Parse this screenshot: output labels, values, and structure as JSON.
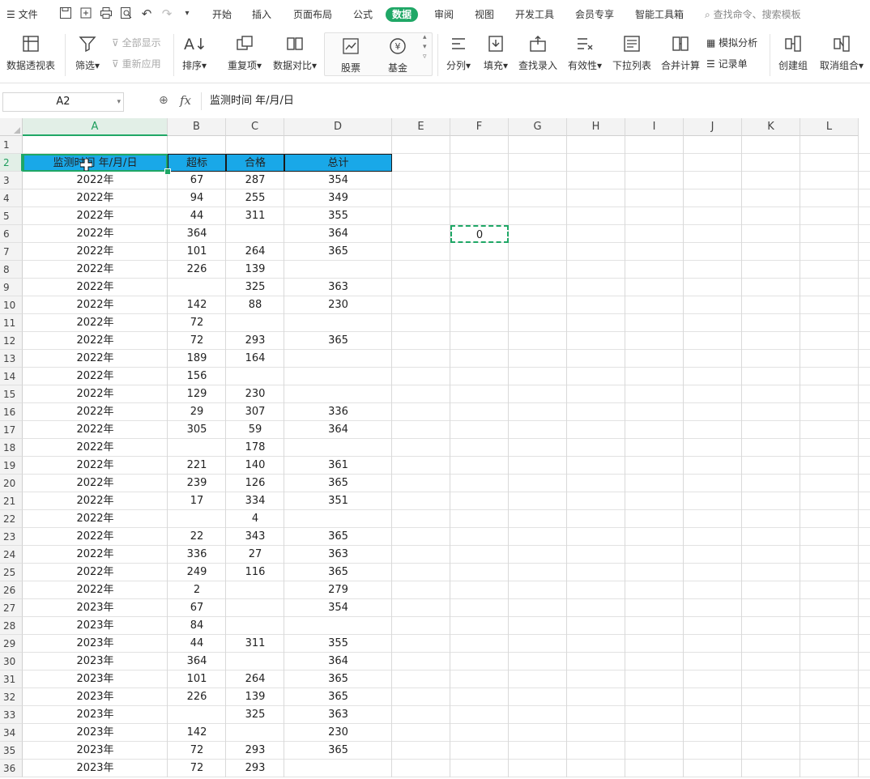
{
  "menubar": {
    "file_label": "文件",
    "tabs": [
      "开始",
      "插入",
      "页面布局",
      "公式",
      "数据",
      "审阅",
      "视图",
      "开发工具",
      "会员专享",
      "智能工具箱"
    ],
    "active_tab": "数据",
    "search_placeholder": "查找命令、搜索模板"
  },
  "ribbon": {
    "pivot": "数据透视表",
    "filter": "筛选",
    "show_all": "全部显示",
    "reapply": "重新应用",
    "sort": "排序",
    "duplicates": "重复项",
    "compare": "数据对比",
    "stock": "股票",
    "fund": "基金",
    "split": "分列",
    "fill": "填充",
    "lookup": "查找录入",
    "validity": "有效性",
    "dropdown": "下拉列表",
    "consolidate": "合并计算",
    "simulate": "模拟分析",
    "record": "记录单",
    "group": "创建组",
    "ungroup": "取消组合"
  },
  "formula_bar": {
    "name_box": "A2",
    "fx": "fx",
    "content": "监测时间 年/月/日"
  },
  "columns": [
    "A",
    "B",
    "C",
    "D",
    "E",
    "F",
    "G",
    "H",
    "I",
    "J",
    "K",
    "L"
  ],
  "rows": [
    "1",
    "2",
    "3",
    "4",
    "5",
    "6",
    "7",
    "8",
    "9",
    "10",
    "11",
    "12",
    "13",
    "14",
    "15",
    "16",
    "17",
    "18",
    "19",
    "20",
    "21",
    "22",
    "23",
    "24",
    "25",
    "26",
    "27",
    "28",
    "29",
    "30",
    "31",
    "32",
    "33",
    "34",
    "35",
    "36"
  ],
  "selected_cell": "A2",
  "header_row": [
    "监测时间 年/月/日",
    "超标",
    "合格",
    "总计"
  ],
  "data_rows": [
    [
      "2022年",
      "67",
      "287",
      "354"
    ],
    [
      "2022年",
      "94",
      "255",
      "349"
    ],
    [
      "2022年",
      "44",
      "311",
      "355"
    ],
    [
      "2022年",
      "364",
      "",
      "364"
    ],
    [
      "2022年",
      "101",
      "264",
      "365"
    ],
    [
      "2022年",
      "226",
      "139",
      ""
    ],
    [
      "2022年",
      "",
      "325",
      "363"
    ],
    [
      "2022年",
      "142",
      "88",
      "230"
    ],
    [
      "2022年",
      "72",
      "",
      ""
    ],
    [
      "2022年",
      "72",
      "293",
      "365"
    ],
    [
      "2022年",
      "189",
      "164",
      ""
    ],
    [
      "2022年",
      "156",
      "",
      ""
    ],
    [
      "2022年",
      "129",
      "230",
      ""
    ],
    [
      "2022年",
      "29",
      "307",
      "336"
    ],
    [
      "2022年",
      "305",
      "59",
      "364"
    ],
    [
      "2022年",
      "",
      "178",
      ""
    ],
    [
      "2022年",
      "221",
      "140",
      "361"
    ],
    [
      "2022年",
      "239",
      "126",
      "365"
    ],
    [
      "2022年",
      "17",
      "334",
      "351"
    ],
    [
      "2022年",
      "",
      "4",
      ""
    ],
    [
      "2022年",
      "22",
      "343",
      "365"
    ],
    [
      "2022年",
      "336",
      "27",
      "363"
    ],
    [
      "2022年",
      "249",
      "116",
      "365"
    ],
    [
      "2022年",
      "2",
      "",
      "279"
    ],
    [
      "2023年",
      "67",
      "",
      "354"
    ],
    [
      "2023年",
      "84",
      "",
      ""
    ],
    [
      "2023年",
      "44",
      "311",
      "355"
    ],
    [
      "2023年",
      "364",
      "",
      "364"
    ],
    [
      "2023年",
      "101",
      "264",
      "365"
    ],
    [
      "2023年",
      "226",
      "139",
      "365"
    ],
    [
      "2023年",
      "",
      "325",
      "363"
    ],
    [
      "2023年",
      "142",
      "",
      "230"
    ],
    [
      "2023年",
      "72",
      "293",
      "365"
    ],
    [
      "2023年",
      "72",
      "293",
      ""
    ]
  ],
  "f6_value": "0",
  "colors": {
    "accent": "#1fa766",
    "header_fill": "#19a8e8"
  }
}
